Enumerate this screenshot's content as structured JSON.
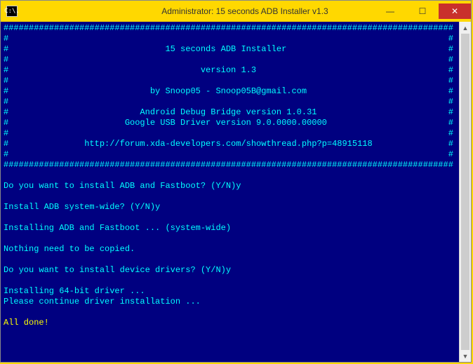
{
  "window": {
    "title": "Administrator:  15 seconds ADB Installer v1.3",
    "icon_text": "C:\\.",
    "controls": {
      "minimize": "—",
      "maximize": "☐",
      "close": "✕"
    }
  },
  "console": {
    "border_full": "#########################################################################################",
    "border_side": "#",
    "header": {
      "title": "15 seconds ADB Installer",
      "version": "version 1.3",
      "author": "by Snoop05 - Snoop05B@gmail.com",
      "adb_version": "Android Debug Bridge version 1.0.31",
      "usb_driver": "Google USB Driver version 9.0.0000.00000",
      "url": "http://forum.xda-developers.com/showthread.php?p=48915118"
    },
    "lines": [
      "Do you want to install ADB and Fastboot? (Y/N)y",
      "",
      "Install ADB system-wide? (Y/N)y",
      "",
      "Installing ADB and Fastboot ... (system-wide)",
      "",
      "Nothing need to be copied.",
      "",
      "Do you want to install device drivers? (Y/N)y",
      "",
      "Installing 64-bit driver ...",
      "Please continue driver installation ...",
      "",
      "All done!"
    ]
  }
}
